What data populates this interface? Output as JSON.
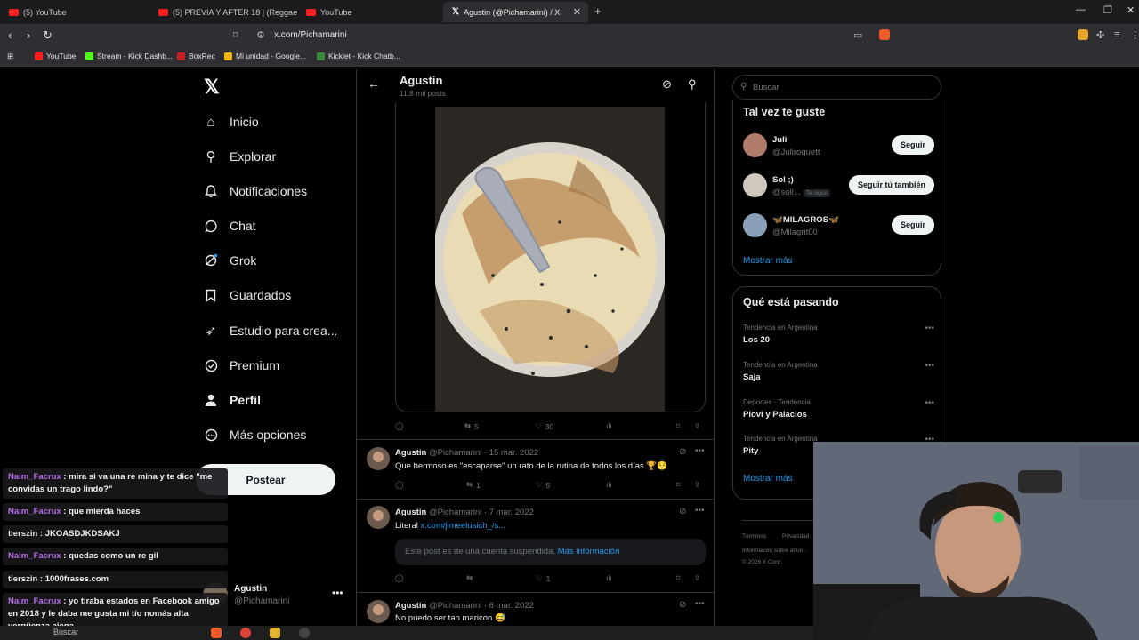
{
  "browser": {
    "tabs": [
      {
        "title": "(5) YouTube",
        "icon": "youtube-icon"
      },
      {
        "title": "(5) PREVIA Y AFTER 18 | (Reggaeton",
        "icon": "youtube-icon"
      },
      {
        "title": "YouTube",
        "icon": "youtube-icon"
      },
      {
        "title": "Agustin (@Pichamarini) / X",
        "icon": "x-icon"
      }
    ],
    "url": "x.com/Pichamarini",
    "bookmarks": [
      "YouTube",
      "Stream - Kick Dashb...",
      "BoxRec",
      "Mi unidad - Google...",
      "Kicklet - Kick Chatb..."
    ]
  },
  "nav": {
    "items": [
      {
        "label": "Inicio",
        "icon": "home-icon",
        "glyph": "⌂"
      },
      {
        "label": "Explorar",
        "icon": "search-icon",
        "glyph": "⚲"
      },
      {
        "label": "Notificaciones",
        "icon": "bell-icon",
        "glyph": "🔔"
      },
      {
        "label": "Chat",
        "icon": "chat-icon",
        "glyph": "◯"
      },
      {
        "label": "Grok",
        "icon": "grok-icon",
        "glyph": "⊘"
      },
      {
        "label": "Guardados",
        "icon": "bookmark-icon",
        "glyph": "⌑"
      },
      {
        "label": "Estudio para crea...",
        "icon": "rocket-icon",
        "glyph": "➶"
      },
      {
        "label": "Premium",
        "icon": "verified-icon",
        "glyph": "✓"
      },
      {
        "label": "Perfil",
        "icon": "person-icon",
        "glyph": "●"
      },
      {
        "label": "Más opciones",
        "icon": "more-circle-icon",
        "glyph": "⋯"
      }
    ],
    "post_label": "Postear",
    "account": {
      "name": "Agustin",
      "handle": "@Pichamarini"
    }
  },
  "header": {
    "title": "Agustin",
    "subtitle": "11,8 mil posts"
  },
  "first_post_actions": {
    "replies": "",
    "reposts": "5",
    "likes": "30"
  },
  "tweets": [
    {
      "name": "Agustin",
      "handle": "@Pichamarini",
      "date": "· 15 mar. 2022",
      "text": "Que hermoso es \"escaparse\" un rato de la rutina de todos los días 🏆😌",
      "reposts": "1",
      "likes": "5"
    },
    {
      "name": "Agustin",
      "handle": "@Pichamarini",
      "date": "· 7 mar. 2022",
      "text_prefix": "Literal ",
      "link": "x.com/jimeelusich_/s...",
      "suspended_text": "Este post es de una cuenta suspendida.",
      "suspended_link": "Más información",
      "reposts": "",
      "likes": "1"
    },
    {
      "name": "Agustin",
      "handle": "@Pichamarini",
      "date": "· 6 mar. 2022",
      "text": "No puedo ser tan maricon 😅"
    }
  ],
  "sidebar": {
    "search_placeholder": "Buscar",
    "who_title": "Tal vez te guste",
    "who": [
      {
        "name": "Juli",
        "handle": "@Juliroquett",
        "button": "Seguir"
      },
      {
        "name": "Sol ;)",
        "handle": "@soll...",
        "follows_you": "Te sigue",
        "button": "Seguir tú también"
      },
      {
        "name": "🦋MILAGROS🦋",
        "handle": "@Milagrit00",
        "button": "Seguir"
      }
    ],
    "show_more": "Mostrar más",
    "trends_title": "Qué está pasando",
    "trends": [
      {
        "context": "Tendencia en Argentina",
        "topic": "Los 20"
      },
      {
        "context": "Tendencia en Argentina",
        "topic": "Saja"
      },
      {
        "context": "Deportes · Tendencia",
        "topic": "Piovi y Palacios"
      },
      {
        "context": "Tendencia en Argentina",
        "topic": "Pity"
      }
    ],
    "trends_more": "Mostrar más",
    "footer": [
      "Términos",
      "·",
      "Privacidad",
      "Información sobre anun...",
      "© 2026 X Corp."
    ]
  },
  "chat": [
    {
      "user": "Naim_Facrux",
      "msg": "mira si va una re mina y te dice \"me convidas un trago lindo?\"",
      "color": "purple"
    },
    {
      "user": "Naim_Facrux",
      "msg": "que mierda haces",
      "color": "purple"
    },
    {
      "user": "tierszin",
      "msg": "JKOASDJKDSAKJ",
      "color": "white"
    },
    {
      "user": "Naim_Facrux",
      "msg": "quedas como un re gil",
      "color": "purple"
    },
    {
      "user": "tierszin",
      "msg": "1000frases.com",
      "color": "white"
    },
    {
      "user": "Naim_Facrux",
      "msg": "yo tiraba estados en Facebook amigo en 2018 y le daba me gusta mi tío nomás alta vergüenza ajena",
      "color": "purple"
    }
  ],
  "taskbar": {
    "search": "Buscar"
  },
  "colors": {
    "accent": "#1d9bf0",
    "chat_user": "#b46ee6",
    "follow_bg": "#eff3f4"
  }
}
